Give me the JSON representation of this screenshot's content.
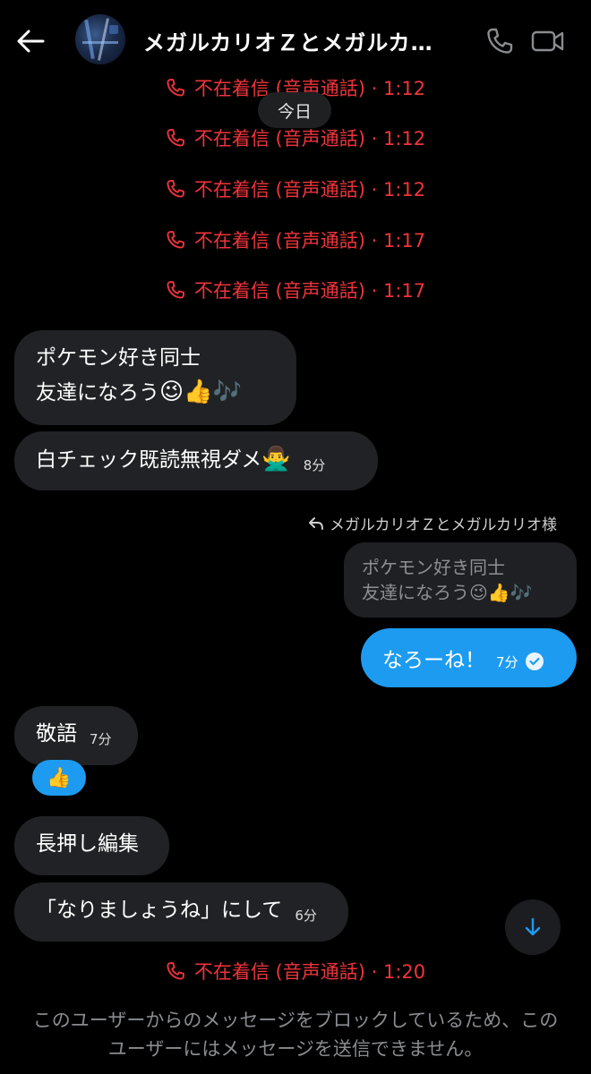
{
  "header": {
    "title": "メガルカリオＺとメガルカリ…",
    "back_icon": "arrow-left-icon",
    "phone_icon": "phone-icon",
    "video_icon": "video-icon"
  },
  "date_chip": "今日",
  "missed_calls": [
    {
      "label": "不在着信 (音声通話) · 1:12"
    },
    {
      "label": "不在着信 (音声通話) · 1:12"
    },
    {
      "label": "不在着信 (音声通話) · 1:12"
    },
    {
      "label": "不在着信 (音声通話) · 1:17"
    },
    {
      "label": "不在着信 (音声通話) · 1:17"
    }
  ],
  "messages": {
    "m1_line1": "ポケモン好き同士",
    "m1_line2": "友達になろう",
    "m1_emoji": "😉👍🎶",
    "m2_text": "白チェック既読無視ダメ",
    "m2_emoji": "🙅‍♂️",
    "m2_time": "8分",
    "reply_to": "メガルカリオＺとメガルカリオ様",
    "quoted_line1": "ポケモン好き同士",
    "quoted_line2": "友達になろう",
    "quoted_emoji": "😉👍🎶",
    "out_text": "なろーね！",
    "out_time": "7分",
    "m3_text": "敬語",
    "m3_time": "7分",
    "reaction": "👍",
    "m4_text": "長押し編集",
    "m5_text": "「なりましょうね」にして",
    "m5_time": "6分"
  },
  "last_missed": "不在着信 (音声通話) · 1:20",
  "blocked_notice": "このユーザーからのメッセージをブロックしているため、このユーザーにはメッセージを送信できません。",
  "colors": {
    "missed_red": "#f0343c",
    "accent_blue": "#1d9bf0",
    "bubble_gray": "#202225"
  }
}
